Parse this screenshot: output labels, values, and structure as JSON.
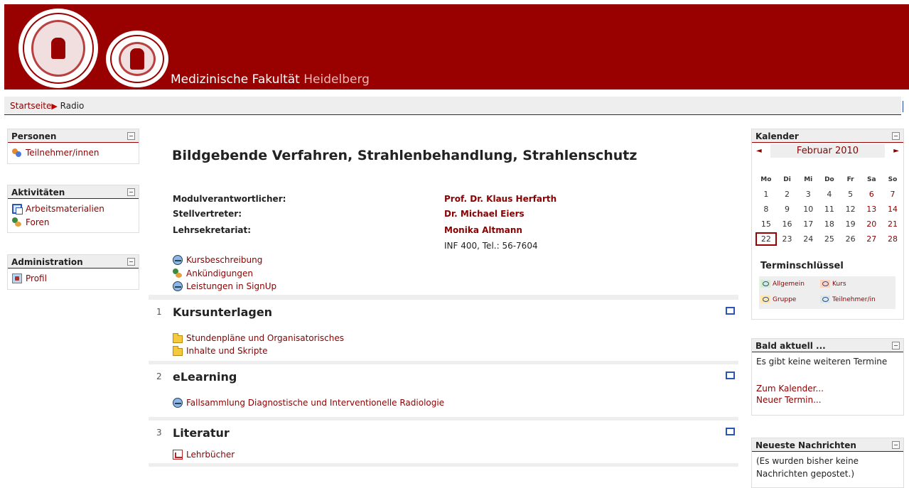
{
  "header": {
    "title_main": "Medizinische Fakultät",
    "title_sub": "Heidelberg"
  },
  "breadcrumb": {
    "home": "Startseite",
    "separator": "▶",
    "current": "Radio"
  },
  "blocks": {
    "personen": {
      "title": "Personen",
      "items": [
        {
          "label": "Teilnehmer/innen",
          "icon": "participants-icon"
        }
      ]
    },
    "aktivitaeten": {
      "title": "Aktivitäten",
      "items": [
        {
          "label": "Arbeitsmaterialien",
          "icon": "resources-icon"
        },
        {
          "label": "Foren",
          "icon": "forums-icon"
        }
      ]
    },
    "administration": {
      "title": "Administration",
      "items": [
        {
          "label": "Profil",
          "icon": "profile-icon"
        }
      ]
    }
  },
  "course": {
    "title": "Bildgebende Verfahren, Strahlenbehandlung, Strahlenschutz",
    "info": [
      {
        "label": "Modulverantwortlicher:",
        "value": "Prof. Dr. Klaus Herfarth"
      },
      {
        "label": "Stellvertreter:",
        "value": "Dr. Michael Eiers"
      },
      {
        "label": "Lehrsekretariat:",
        "value": "Monika Altmann"
      }
    ],
    "contact": "INF 400, Tel.: 56-7604",
    "links": [
      "Kursbeschreibung",
      "Ankündigungen",
      "Leistungen in SignUp"
    ]
  },
  "sections": [
    {
      "number": "1",
      "title": "Kursunterlagen",
      "items": [
        "Stundenpläne und Organisatorisches",
        "Inhalte und Skripte"
      ]
    },
    {
      "number": "2",
      "title": "eLearning",
      "items": [
        "Fallsammlung Diagnostische und Interventionelle Radiologie"
      ]
    },
    {
      "number": "3",
      "title": "Literatur",
      "items": [
        "Lehrbücher"
      ]
    }
  ],
  "calendar": {
    "title": "Kalender",
    "month": "Februar 2010",
    "prev": "◄",
    "next": "►",
    "weekdays": [
      "Mo",
      "Di",
      "Mi",
      "Do",
      "Fr",
      "Sa",
      "So"
    ],
    "weeks": [
      [
        "1",
        "2",
        "3",
        "4",
        "5",
        "6",
        "7"
      ],
      [
        "8",
        "9",
        "10",
        "11",
        "12",
        "13",
        "14"
      ],
      [
        "15",
        "16",
        "17",
        "18",
        "19",
        "20",
        "21"
      ],
      [
        "22",
        "23",
        "24",
        "25",
        "26",
        "27",
        "28"
      ]
    ],
    "today": "22",
    "key_title": "Terminschlüssel",
    "key": [
      {
        "label": "Allgemein",
        "color": "#d6ecd2"
      },
      {
        "label": "Kurs",
        "color": "#ffd3bd"
      },
      {
        "label": "Gruppe",
        "color": "#fee7ae"
      },
      {
        "label": "Teilnehmer/in",
        "color": "#dce7ec"
      }
    ]
  },
  "upcoming": {
    "title": "Bald aktuell ...",
    "empty": "Es gibt keine weiteren Termine",
    "link_calendar": "Zum Kalender...",
    "link_new": "Neuer Termin..."
  },
  "news": {
    "title": "Neueste Nachrichten",
    "line1": "(Es wurden bisher keine",
    "line2": "Nachrichten gepostet.)"
  },
  "colors": {
    "brand": "#990000",
    "link": "#8b0000",
    "panel_grey": "#eeeeee"
  }
}
